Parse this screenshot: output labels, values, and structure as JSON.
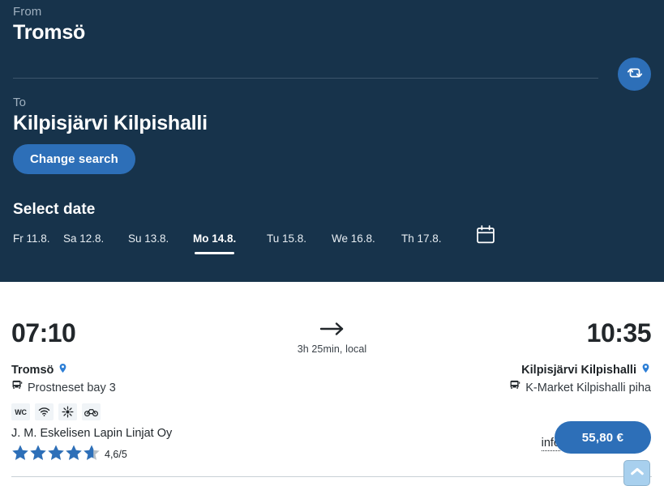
{
  "search": {
    "from_label": "From",
    "from_value": "Tromsö",
    "to_label": "To",
    "to_value": "Kilpisjärvi Kilpishalli",
    "change_search_label": "Change search",
    "swap_icon": "swap-arrows-icon",
    "select_date_label": "Select date",
    "calendar_icon": "calendar-icon",
    "dates": [
      {
        "label": "Fr 11.8.",
        "selected": false
      },
      {
        "label": "Sa 12.8.",
        "selected": false
      },
      {
        "label": "Su 13.8.",
        "selected": false
      },
      {
        "label": "Mo 14.8.",
        "selected": true
      },
      {
        "label": "Tu 15.8.",
        "selected": false
      },
      {
        "label": "We 16.8.",
        "selected": false
      },
      {
        "label": "Th 17.8.",
        "selected": false
      }
    ]
  },
  "result": {
    "departure_time": "07:10",
    "arrival_time": "10:35",
    "departure_stop": "Tromsö",
    "arrival_stop": "Kilpisjärvi Kilpishalli",
    "departure_platform": "Prostneset bay 3",
    "arrival_platform": "K-Market Kilpishalli piha",
    "duration": "3h 25min, local",
    "arrow_icon": "arrow-right-icon",
    "pin_icon": "map-pin-icon",
    "bus_icon": "bus-icon",
    "amenities": [
      {
        "name": "wc-icon",
        "label": "WC"
      },
      {
        "name": "wifi-icon",
        "label": ""
      },
      {
        "name": "air-conditioning-icon",
        "label": ""
      },
      {
        "name": "bicycle-icon",
        "label": ""
      }
    ],
    "operator": "J. M. Eskelisen Lapin Linjat Oy",
    "rating_value": "4,6/5",
    "rating_stars": 4.6,
    "info_label": "info",
    "price": "55,80 €"
  },
  "scroll_top": {
    "icon": "chevron-up-icon"
  },
  "colors": {
    "header_bg": "#17334b",
    "accent_blue": "#2d6fb8",
    "muted_label": "#9fb0bf",
    "divider": "#3c556b",
    "text_dark": "#22282d",
    "scroll_top_bg": "#a8d0ee"
  }
}
